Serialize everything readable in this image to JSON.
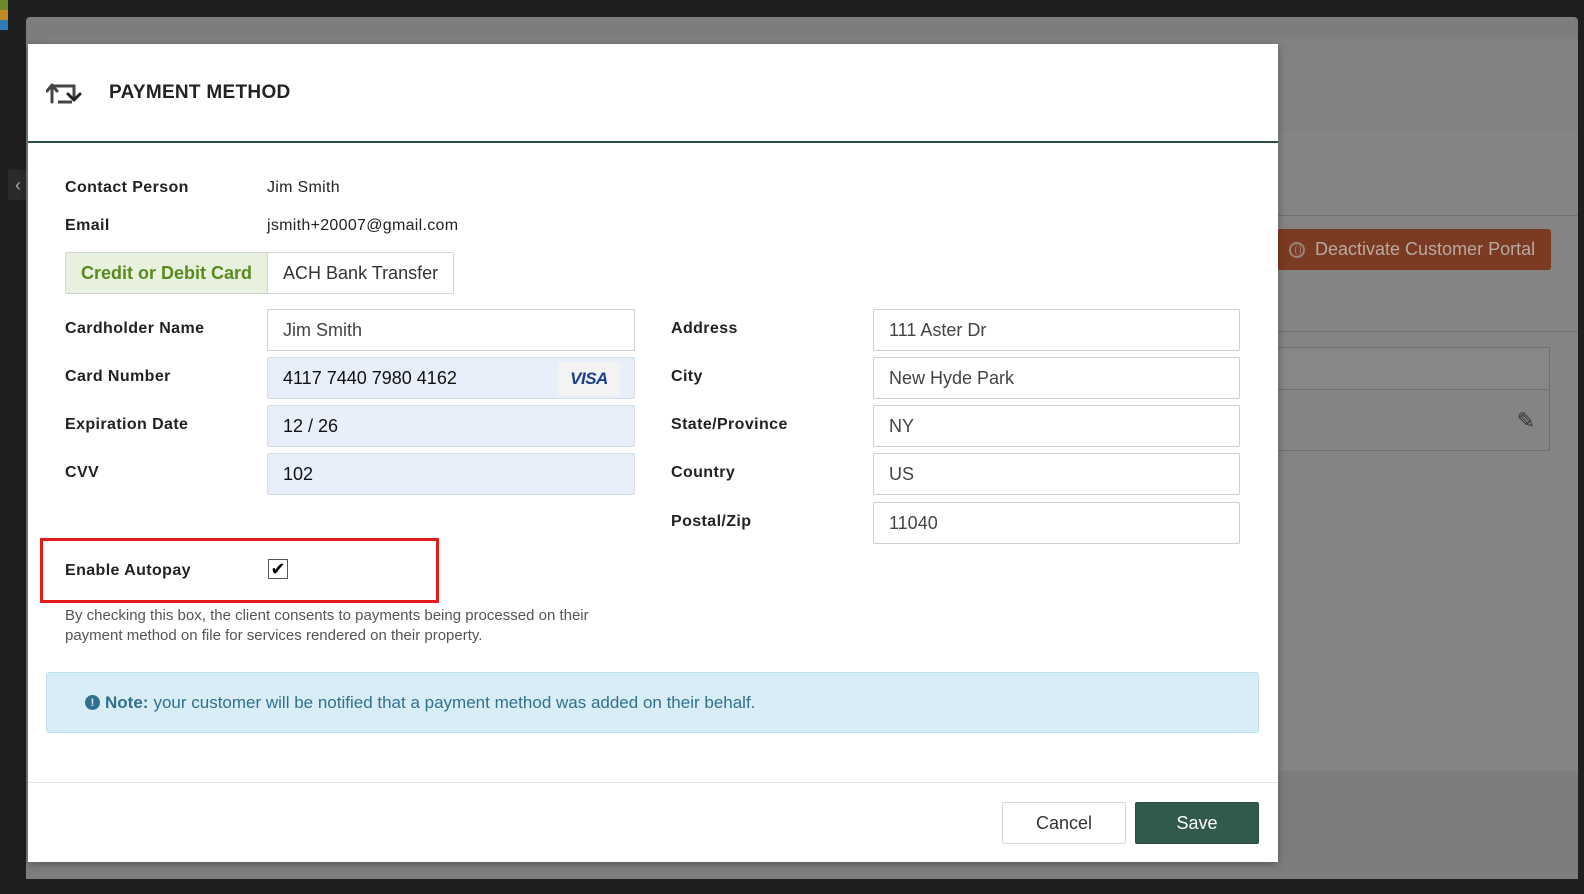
{
  "background": {
    "deactivate_button_label": "Deactivate Customer Portal",
    "edit_icon": "pencil-icon"
  },
  "modal": {
    "title": "PAYMENT METHOD",
    "header_icon": "swap-arrows-icon",
    "contact_person_label": "Contact Person",
    "contact_person_value": "Jim Smith",
    "email_label": "Email",
    "email_value": "jsmith+20007@gmail.com",
    "tabs": [
      {
        "label": "Credit or Debit Card",
        "active": true
      },
      {
        "label": "ACH Bank Transfer",
        "active": false
      }
    ],
    "card": {
      "cardholder_label": "Cardholder Name",
      "cardholder_value": "Jim Smith",
      "card_number_label": "Card Number",
      "card_number_value": "4117 7440 7980 4162",
      "card_brand": "VISA",
      "expiration_label": "Expiration Date",
      "expiration_value": "12 / 26",
      "cvv_label": "CVV",
      "cvv_value": "102"
    },
    "address": {
      "address_label": "Address",
      "address_value": "111 Aster Dr",
      "city_label": "City",
      "city_value": "New Hyde Park",
      "state_label": "State/Province",
      "state_value": "NY",
      "country_label": "Country",
      "country_value": "US",
      "postal_label": "Postal/Zip",
      "postal_value": "11040"
    },
    "autopay": {
      "label": "Enable Autopay",
      "checked": true,
      "check_mark": "✔",
      "consent_text": "By checking this box, the client consents to payments being processed on their payment method on file for services rendered on their property."
    },
    "note": {
      "icon": "!",
      "strong": "Note:",
      "text": "your customer will be notified that a payment method was added on their behalf."
    },
    "footer": {
      "cancel_label": "Cancel",
      "save_label": "Save"
    },
    "colors": {
      "primary": "#315a4c",
      "active_tab_text": "#5a8a1f",
      "highlight_border": "#e21a1a",
      "note_bg": "#d9edf7"
    }
  }
}
